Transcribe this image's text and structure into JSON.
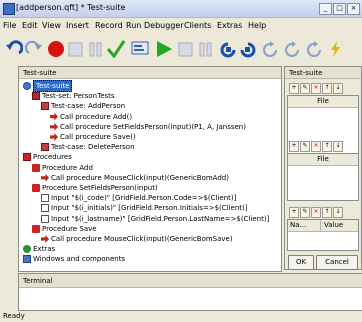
{
  "window": {
    "title": "[addperson.qft] * Test-suite",
    "controls": [
      "_",
      "□",
      "×"
    ]
  },
  "menu": [
    "File",
    "Edit",
    "View",
    "Insert",
    "Record",
    "Run",
    "Debugger",
    "Clients",
    "Extras",
    "Help"
  ],
  "toolbar_icons": [
    "undo-icon",
    "redo-icon",
    "record-icon",
    "stop-record-icon",
    "pause-record-icon",
    "checkmark-icon",
    "capture-icon",
    "play-icon",
    "stop-icon",
    "pause-icon",
    "step-into-icon",
    "step-over-icon",
    "step-out-icon",
    "continue-icon",
    "debug-icon"
  ],
  "tree": {
    "pane_title": "Test-suite",
    "rows": [
      {
        "label": "Test-suite",
        "indent": 0,
        "icon": "test-suite-icon",
        "selected": true
      },
      {
        "label": "Test-set: PersonTests",
        "indent": 1,
        "icon": "test-set-icon"
      },
      {
        "label": "Test-case: AddPerson",
        "indent": 2,
        "icon": "test-case-icon"
      },
      {
        "label": "Call procedure Add()",
        "indent": 3,
        "icon": "call-procedure-icon"
      },
      {
        "label": "Call procedure SetFieldsPerson(input)(P1, A, Janssen)",
        "indent": 3,
        "icon": "call-procedure-icon"
      },
      {
        "label": "Call procedure Save()",
        "indent": 3,
        "icon": "call-procedure-icon"
      },
      {
        "label": "Test-case: DeletePerson",
        "indent": 2,
        "icon": "test-case-icon"
      },
      {
        "label": "Procedures",
        "indent": 0,
        "icon": "procedures-icon"
      },
      {
        "label": "Procedure Add",
        "indent": 1,
        "icon": "procedure-icon"
      },
      {
        "label": "Call procedure MouseClick(input)(GenericBomAdd)",
        "indent": 2,
        "icon": "call-procedure-icon"
      },
      {
        "label": "Procedure SetFieldsPerson(input)",
        "indent": 1,
        "icon": "procedure-icon"
      },
      {
        "label": "Input \"$(i_code)\" [GridField.Person.Code=>$(Client)]",
        "indent": 2,
        "icon": "input-icon"
      },
      {
        "label": "Input \"$(i_initials)\" [GridField.Person.Initials=>$(Client)]",
        "indent": 2,
        "icon": "input-icon"
      },
      {
        "label": "Input \"$(i_lastname)\" [GridField.Person.LastName=>$(Client)]",
        "indent": 2,
        "icon": "input-icon"
      },
      {
        "label": "Procedure Save",
        "indent": 1,
        "icon": "procedure-icon"
      },
      {
        "label": "Call procedure MouseClick(input)(GenericBomSave)",
        "indent": 2,
        "icon": "call-procedure-icon"
      },
      {
        "label": "Extras",
        "indent": 0,
        "icon": "extras-icon"
      },
      {
        "label": "Windows and components",
        "indent": 0,
        "icon": "windows-components-icon"
      }
    ]
  },
  "side_panel": {
    "title": "Test-suite",
    "list1_header": "File",
    "list2_header": "File",
    "table_headers": [
      "Na...",
      "Value"
    ],
    "ok_label": "OK",
    "cancel_label": "Cancel"
  },
  "terminal": {
    "title": "Terminal"
  },
  "status": "Ready",
  "colors": {
    "record": "#d91010",
    "play": "#1ea91e",
    "checkmark": "#2aa52a",
    "toolbar_blue": "#1a4fb3",
    "procedure_red": "#cc2222",
    "call_arrow": "#c0281c",
    "selection": "#316ac5"
  }
}
